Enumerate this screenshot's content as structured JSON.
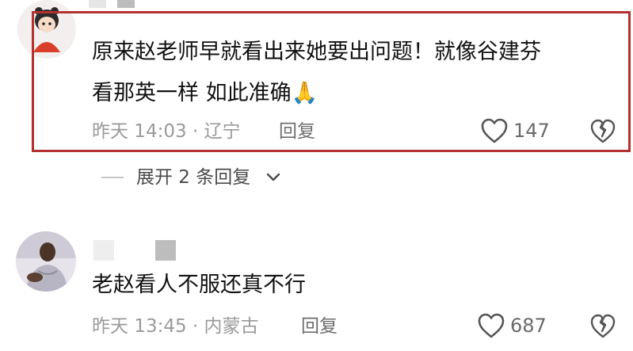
{
  "comments": [
    {
      "text_line1": "原来赵老师早就看出来她要出问题！就像谷建芬",
      "text_line2": "看那英一样 如此准确",
      "emoji": "🙏",
      "time": "昨天 14:03 · 辽宁",
      "reply_label": "回复",
      "likes": "147",
      "expand_label": "展开 2 条回复"
    },
    {
      "text_line1": "老赵看人不服还真不行",
      "time": "昨天 13:45 · 内蒙古",
      "reply_label": "回复",
      "likes": "687"
    }
  ],
  "icons": {
    "like": "heart-outline-icon",
    "dislike": "broken-heart-icon",
    "expand": "chevron-down-icon"
  },
  "colors": {
    "highlight_border": "#b3312f",
    "meta_text": "#9a9a9a",
    "icon_stroke": "#555555"
  }
}
